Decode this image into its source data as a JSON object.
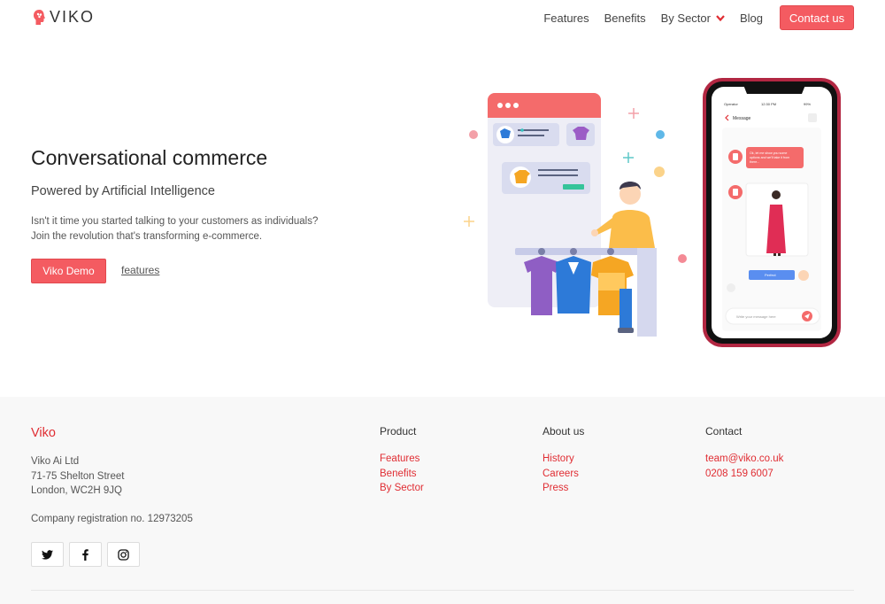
{
  "nav": {
    "logo_text": "VIKO",
    "links": [
      {
        "label": "Features"
      },
      {
        "label": "Benefits"
      },
      {
        "label": "By Sector"
      },
      {
        "label": "Blog"
      }
    ],
    "cta_label": "Contact us"
  },
  "hero": {
    "title": "Conversational commerce",
    "subtitle": "Powered by Artificial Intelligence",
    "body_line1": "Isn't it time you started talking to your customers as individuals?",
    "body_line2": "Join the revolution that's transforming e-commerce.",
    "primary_button": "Viko Demo",
    "secondary_link": "features"
  },
  "phone": {
    "status_left": "Operator",
    "status_time": "12:30 PM",
    "status_right": "99%",
    "header": "Message",
    "bot_text": "Ok, let me show you some options and we'll take it from there...",
    "user_button": "Perfect",
    "input_placeholder": "Write your message here"
  },
  "footer": {
    "brand": "Viko",
    "address": [
      "Viko Ai Ltd",
      "71-75 Shelton Street",
      "London, WC2H 9JQ"
    ],
    "registration": "Company registration no. 12973205",
    "columns": [
      {
        "title": "Product",
        "links": [
          "Features",
          "Benefits",
          "By Sector"
        ]
      },
      {
        "title": "About us",
        "links": [
          "History",
          "Careers",
          "Press"
        ]
      },
      {
        "title": "Contact",
        "links": [
          "team@viko.co.uk",
          "0208 159 6007"
        ]
      }
    ],
    "social": [
      "twitter-icon",
      "facebook-icon",
      "instagram-icon"
    ]
  },
  "colors": {
    "accent": "#f45b61",
    "brand_red": "#e02d33",
    "footer_bg": "#f8f8f8"
  }
}
